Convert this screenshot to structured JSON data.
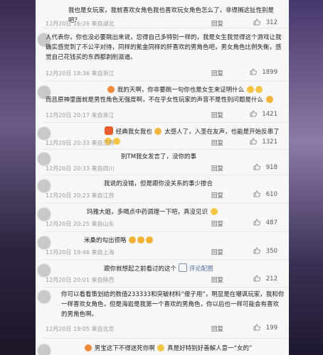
{
  "comments": [
    {
      "text": "我也是女玩家，我就喜欢女角色我也喜欢玩女角色怎么了，非得搁这扯性别是吧？",
      "time": "12月20日 16:26 来自湖北",
      "reply": "回复",
      "likes": "312"
    },
    {
      "name": "",
      "text": "人代表你，你也没必要跳出来说，您得自己多特别一样的，我是女生我觉得这个游戏让我确实感觉到了不公平对待，同样的氪金同样的肝喜欢的男角色吧，男女角色比例失衡，感觉自己花钱买的东西都剥削滋道。",
      "time": "12月20日 18:36 来自浙江",
      "reply": "回复",
      "likes": "1899"
    },
    {
      "name": "",
      "text": "我的天啊，你非要跳一句你也是女生来证明什么",
      "text2": "而且原神里面就是男性角色无强度啊，不在乎女性玩家的声音不是性别问题是什么",
      "time": "12月20日 20:17 来自浙江",
      "reply": "回复",
      "likes": "1421"
    },
    {
      "name": "",
      "text": "经典我女我也",
      "text2": "太感人了，入圣在友声，也能是开始反串了",
      "time": "12月20日 20:33 来自江苏",
      "reply": "回复",
      "likes": "1321"
    },
    {
      "name": "",
      "text": "别TM我女发言了，没你的事",
      "time": "12月20日 20:33 来自四川",
      "reply": "回复",
      "likes": "918"
    },
    {
      "name": "",
      "text": "我说的没错，但是跟你没关系的事少掺合",
      "time": "12月20日 20:23 来自江苏",
      "reply": "回复",
      "likes": "610"
    },
    {
      "name": "",
      "text": "玛雅大姐，多喝点中药调理一下吧，真没见识",
      "time": "12月20日 20:25 来自山东",
      "reply": "回复",
      "likes": "487"
    },
    {
      "name": "",
      "text": "米桑的勾出很略",
      "time": "12月20日 19:46 来自上海",
      "reply": "回复",
      "likes": "350"
    },
    {
      "name": "",
      "text": "跟你就想起之前看过的这个",
      "link": "评论配图",
      "time": "12月20日 20:01 来自陕西",
      "reply": "回复",
      "likes": "212"
    },
    {
      "name": "",
      "text": "你可以看看策划给的数值233333和突破材料“傻子用”，明显是在嘲讽玩家，我和你一样喜欢女角色，但是海岩是我第一个喜欢的男角色，你以后也一样可能会有喜欢的男角色啊。",
      "time": "12月20日 19:05 来自北京",
      "reply": "回复",
      "likes": "199"
    },
    {
      "name": "",
      "text": "男宝这下不得迷死你啊",
      "text2": "真是好特别好善解人意一“女的”",
      "time": "",
      "reply": "",
      "likes": ""
    }
  ]
}
